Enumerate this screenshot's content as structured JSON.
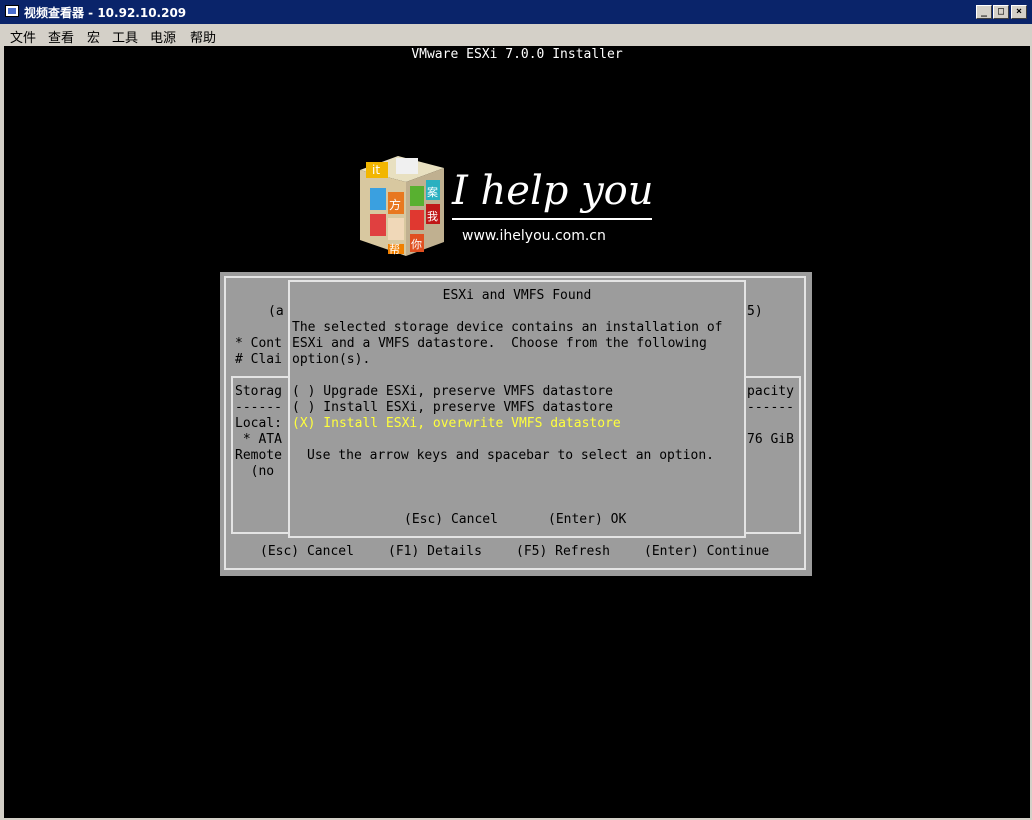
{
  "window": {
    "title": "视频查看器 - 10.92.10.209",
    "min_glyph": "_",
    "max_glyph": "□",
    "close_glyph": "×"
  },
  "menu": [
    "文件",
    "查看",
    "宏",
    "工具",
    "电源",
    "帮助"
  ],
  "console": {
    "header": "VMware ESXi 7.0.0 Installer",
    "watermark": {
      "tagline": "I help you",
      "url": "www.ihelyou.com.cn",
      "cube_chars": [
        "it",
        "方",
        "案",
        "我",
        "帮",
        "你"
      ]
    },
    "background": {
      "line_a": "(a",
      "line_5": "5)",
      "line_cont": "* Cont",
      "line_clai": "# Clai",
      "storag": "Storag",
      "pacity": "pacity",
      "dash_left": "------",
      "dash_right": "------",
      "local": "Local:",
      "ata": " * ATA",
      "size": "76 GiB",
      "remote": "Remote",
      "no": "  (no"
    },
    "footer": {
      "cancel": "(Esc) Cancel",
      "details": "(F1) Details",
      "refresh": "(F5) Refresh",
      "continue": "(Enter) Continue"
    },
    "dialog": {
      "title": "ESXi and VMFS Found",
      "message_lines": [
        "The selected storage device contains an installation of",
        "ESXi and a VMFS datastore.  Choose from the following",
        "option(s)."
      ],
      "options": [
        {
          "label": "( ) Upgrade ESXi, preserve VMFS datastore",
          "selected": false
        },
        {
          "label": "( ) Install ESXi, preserve VMFS datastore",
          "selected": false
        },
        {
          "label": "(X) Install ESXi, overwrite VMFS datastore",
          "selected": true
        }
      ],
      "hint": "Use the arrow keys and spacebar to select an option.",
      "cancel": "(Esc) Cancel",
      "ok": "(Enter) OK"
    },
    "colors": {
      "panel": "#9c9c9c",
      "border": "#e4e4e4",
      "selected": "#ffff3c"
    }
  }
}
